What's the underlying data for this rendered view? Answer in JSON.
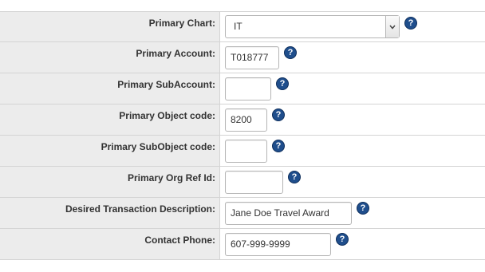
{
  "form": {
    "rows": [
      {
        "label": "Primary Chart:",
        "type": "select",
        "value": "IT",
        "help": "?"
      },
      {
        "label": "Primary Account:",
        "type": "input",
        "value": "T018777",
        "help": "?"
      },
      {
        "label": "Primary SubAccount:",
        "type": "input",
        "value": "",
        "help": "?"
      },
      {
        "label": "Primary Object code:",
        "type": "input",
        "value": "8200",
        "help": "?"
      },
      {
        "label": "Primary SubObject code:",
        "type": "input",
        "value": "",
        "help": "?"
      },
      {
        "label": "Primary Org Ref Id:",
        "type": "input",
        "value": "",
        "help": "?"
      },
      {
        "label": "Desired Transaction Description:",
        "type": "input",
        "value": "Jane Doe Travel Award",
        "help": "?"
      },
      {
        "label": "Contact Phone:",
        "type": "input",
        "value": "607-999-9999",
        "help": "?"
      }
    ]
  },
  "icons": {
    "help": "help-circle-icon",
    "dropdown": "chevron-down-icon"
  },
  "colors": {
    "label_bg": "#ececec",
    "border": "#d4d4d4",
    "help_icon": "#1f4e8c"
  }
}
